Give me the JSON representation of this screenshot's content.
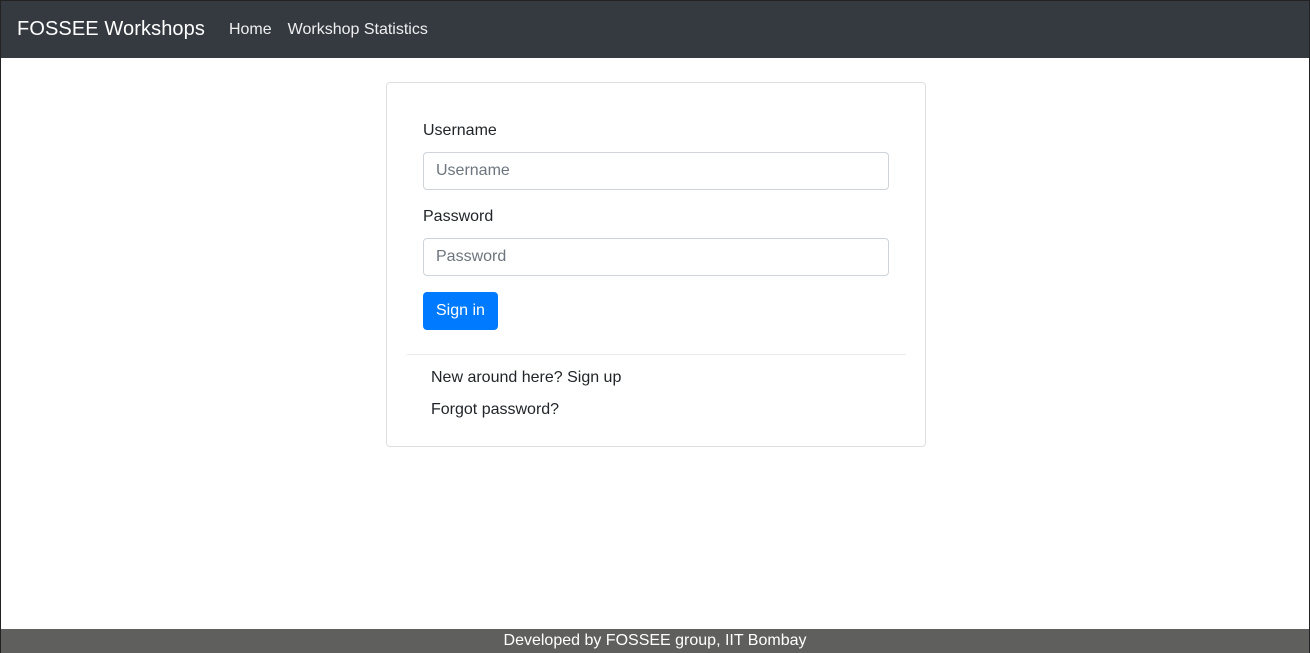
{
  "navbar": {
    "brand": "FOSSEE Workshops",
    "links": [
      {
        "label": "Home"
      },
      {
        "label": "Workshop Statistics"
      }
    ]
  },
  "login_form": {
    "username_label": "Username",
    "username_placeholder": "Username",
    "username_value": "",
    "password_label": "Password",
    "password_placeholder": "Password",
    "password_value": "",
    "submit_label": "Sign in"
  },
  "links": {
    "signup": "New around here? Sign up",
    "forgot_password": "Forgot password?"
  },
  "footer": {
    "text": "Developed by FOSSEE group, IIT Bombay"
  },
  "colors": {
    "navbar_bg": "#343a40",
    "primary": "#007bff",
    "footer_bg": "#5f5f5d"
  }
}
